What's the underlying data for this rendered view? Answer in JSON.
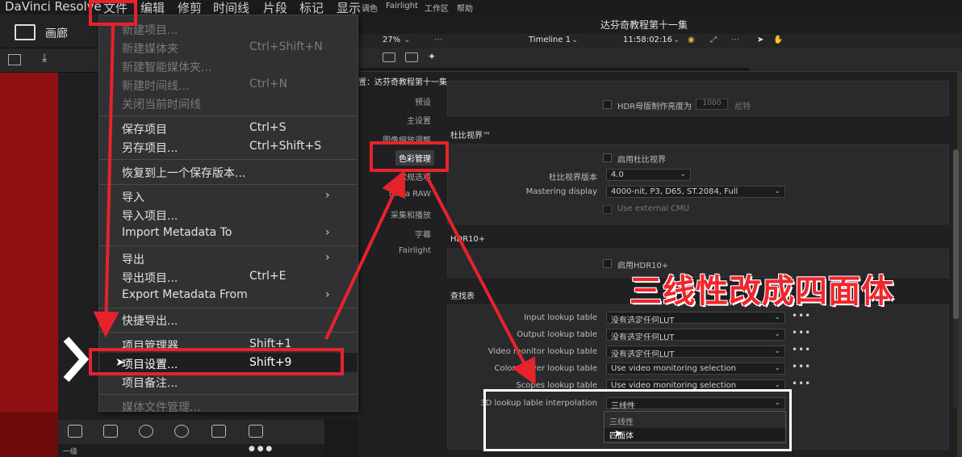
{
  "menubar": {
    "app_name": "DaVinci Resolve",
    "menus": [
      "文件",
      "编辑",
      "修剪",
      "时间线",
      "片段",
      "标记",
      "显示"
    ],
    "small_menus": [
      "调色",
      "Fairlight",
      "工作区",
      "帮助"
    ]
  },
  "left_toolbar": {
    "gallery": "画廊"
  },
  "header": {
    "project_title": "达芬奇教程第十一集"
  },
  "viewer": {
    "zoom": "27%",
    "timeline": "Timeline 1",
    "timecode": "11:58:02:16"
  },
  "file_menu": {
    "items": [
      {
        "label": "新建项目...",
        "shortcut": "",
        "disabled": true
      },
      {
        "label": "新建媒体夹",
        "shortcut": "Ctrl+Shift+N",
        "disabled": true
      },
      {
        "label": "新建智能媒体夹...",
        "shortcut": "",
        "disabled": true
      },
      {
        "label": "新建时间线...",
        "shortcut": "Ctrl+N",
        "disabled": true
      },
      {
        "label": "关闭当前时间线",
        "shortcut": "",
        "disabled": true
      },
      {
        "label": "保存项目",
        "shortcut": "Ctrl+S",
        "disabled": false
      },
      {
        "label": "另存项目...",
        "shortcut": "Ctrl+Shift+S",
        "disabled": false
      },
      {
        "label": "恢复到上一个保存版本...",
        "shortcut": "",
        "disabled": false
      },
      {
        "label": "导入",
        "shortcut": "",
        "disabled": false
      },
      {
        "label": "导入项目...",
        "shortcut": "",
        "disabled": false
      },
      {
        "label": "Import Metadata To",
        "shortcut": "",
        "disabled": false
      },
      {
        "label": "导出",
        "shortcut": "",
        "disabled": false
      },
      {
        "label": "导出项目...",
        "shortcut": "Ctrl+E",
        "disabled": false
      },
      {
        "label": "Export Metadata From",
        "shortcut": "",
        "disabled": false
      },
      {
        "label": "快捷导出...",
        "shortcut": "",
        "disabled": false
      },
      {
        "label": "项目管理器...",
        "shortcut": "Shift+1",
        "disabled": false
      },
      {
        "label": "项目设置...",
        "shortcut": "Shift+9",
        "disabled": false
      },
      {
        "label": "项目备注...",
        "shortcut": "",
        "disabled": false
      },
      {
        "label": "媒体文件管理...",
        "shortcut": "",
        "disabled": true
      }
    ]
  },
  "settings_dialog": {
    "title": "置：达芬奇教程第十一集",
    "nav": [
      "预设",
      "主设置",
      "图像缩放调整",
      "色彩管理",
      "常规选项",
      "mera RAW",
      "采集和播放",
      "字幕",
      "Fairlight"
    ],
    "hdr_master_label": "HDR母版制作亮度为",
    "hdr_master_value": "1000",
    "hdr_master_unit": "尼特",
    "dolby": {
      "title": "杜比视界™",
      "enable": "启用杜比视界",
      "version_label": "杜比视界版本",
      "version_value": "4.0",
      "mastering_label": "Mastering display",
      "mastering_value": "4000-nit, P3, D65, ST.2084, Full",
      "external_cmu": "Use external CMU"
    },
    "hdr10": {
      "title": "HDR10+",
      "enable": "启用HDR10+"
    },
    "lut": {
      "title": "查找表",
      "rows": [
        {
          "label": "Input lookup table",
          "value": "没有选定任何LUT"
        },
        {
          "label": "Output lookup table",
          "value": "没有选定任何LUT"
        },
        {
          "label": "Video monitor lookup table",
          "value": "没有选定任何LUT"
        },
        {
          "label": "Color viewer lookup table",
          "value": "Use video monitoring selection"
        },
        {
          "label": "Scopes lookup table",
          "value": "Use video monitoring selection"
        }
      ],
      "interp_label": "3D lookup lable interpolation",
      "interp_value": "三线性",
      "interp_options": [
        "三线性",
        "四面体"
      ]
    }
  },
  "bottom": {
    "level": "一级"
  },
  "annotation": {
    "text": "三线性改成四面体"
  },
  "colors": {
    "annotation_red": "#e6232b",
    "highlight_box": "#ffffff"
  }
}
